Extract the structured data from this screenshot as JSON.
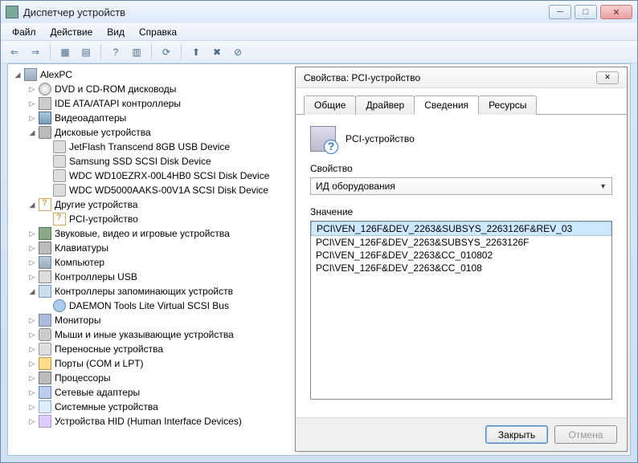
{
  "window": {
    "title": "Диспетчер устройств"
  },
  "menu": {
    "file": "Файл",
    "action": "Действие",
    "view": "Вид",
    "help": "Справка"
  },
  "tree": {
    "root": "AlexPC",
    "items": {
      "cdrom": "DVD и CD-ROM дисководы",
      "ide": "IDE ATA/ATAPI контроллеры",
      "video": "Видеоадаптеры",
      "disks": "Дисковые устройства",
      "disk1": "JetFlash Transcend 8GB USB Device",
      "disk2": "Samsung SSD SCSI Disk Device",
      "disk3": "WDC WD10EZRX-00L4HB0 SCSI Disk Device",
      "disk4": "WDC WD5000AAKS-00V1A SCSI Disk Device",
      "other": "Другие устройства",
      "pci": "PCI-устройство",
      "sound": "Звуковые, видео и игровые устройства",
      "keyboard": "Клавиатуры",
      "computer": "Компьютер",
      "usb": "Контроллеры USB",
      "storage": "Контроллеры запоминающих устройств",
      "daemon": "DAEMON Tools Lite Virtual SCSI Bus",
      "monitor": "Мониторы",
      "mouse": "Мыши и иные указывающие устройства",
      "portable": "Переносные устройства",
      "ports": "Порты (COM и LPT)",
      "cpu": "Процессоры",
      "net": "Сетевые адаптеры",
      "sys": "Системные устройства",
      "hid": "Устройства HID (Human Interface Devices)"
    }
  },
  "dialog": {
    "title": "Свойства: PCI-устройство",
    "tabs": {
      "general": "Общие",
      "driver": "Драйвер",
      "details": "Сведения",
      "resources": "Ресурсы"
    },
    "device_name": "PCI-устройство",
    "property_label": "Свойство",
    "property_selected": "ИД оборудования",
    "value_label": "Значение",
    "values": [
      "PCI\\VEN_126F&DEV_2263&SUBSYS_2263126F&REV_03",
      "PCI\\VEN_126F&DEV_2263&SUBSYS_2263126F",
      "PCI\\VEN_126F&DEV_2263&CC_010802",
      "PCI\\VEN_126F&DEV_2263&CC_0108"
    ],
    "close": "Закрыть",
    "cancel": "Отмена"
  }
}
